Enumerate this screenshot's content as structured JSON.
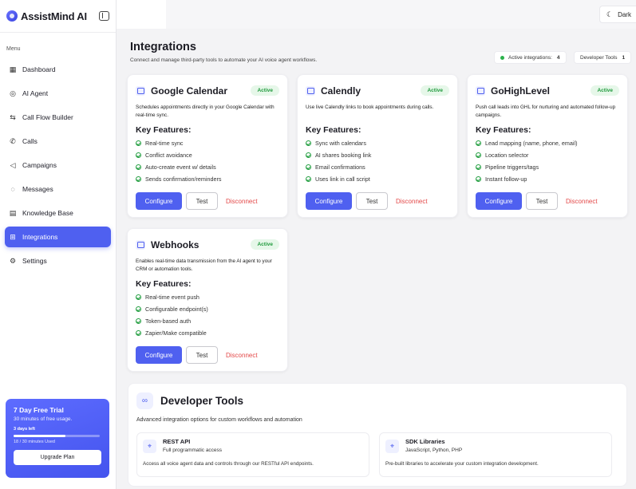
{
  "brand": {
    "name": "AssistMind AI"
  },
  "sidebar": {
    "menu_label": "Menu",
    "items": [
      {
        "label": "Dashboard",
        "icon": "grid-icon",
        "active": false
      },
      {
        "label": "AI Agent",
        "icon": "bot-icon",
        "active": false
      },
      {
        "label": "Call Flow Builder",
        "icon": "flow-icon",
        "active": false
      },
      {
        "label": "Calls",
        "icon": "phone-icon",
        "active": false
      },
      {
        "label": "Campaigns",
        "icon": "megaphone-icon",
        "active": false
      },
      {
        "label": "Messages",
        "icon": "message-icon",
        "active": false
      },
      {
        "label": "Knowledge Base",
        "icon": "book-icon",
        "active": false
      },
      {
        "label": "Integrations",
        "icon": "integrations-icon",
        "active": true
      },
      {
        "label": "Settings",
        "icon": "gear-icon",
        "active": false
      }
    ]
  },
  "trial": {
    "title": "7 Day Free Trial",
    "desc": "30 minutes of free usage.",
    "days_left": "3 days left",
    "usage": "18 / 30 minutes Used",
    "usage_fraction": 0.6,
    "upgrade_label": "Upgrade Plan"
  },
  "topbar": {
    "theme_label": "Dark"
  },
  "header": {
    "title": "Integrations",
    "subtitle": "Connect and manage third-party tools to automate your AI voice agent workflows.",
    "active_label": "Active integrations:",
    "active_count": "4",
    "devtools_label": "Developer Tools",
    "devtools_count": "1"
  },
  "cards": [
    {
      "title": "Google Calendar",
      "status": "Active",
      "desc": "Schedules appointments directly in your Google Calendar with real-time sync.",
      "features_title": "Key Features:",
      "features": [
        "Real-time sync",
        "Conflict avoidance",
        "Auto-create event w/ details",
        "Sends confirmation/reminders"
      ],
      "configure": "Configure",
      "test": "Test",
      "disconnect": "Disconnect"
    },
    {
      "title": "Calendly",
      "status": "Active",
      "desc": "Use live Calendly links to book appointments during calls.",
      "features_title": "Key Features:",
      "features": [
        "Sync with calendars",
        "AI shares booking link",
        "Email confirmations",
        "Uses link in call script"
      ],
      "configure": "Configure",
      "test": "Test",
      "disconnect": "Disconnect"
    },
    {
      "title": "GoHighLevel",
      "status": "Active",
      "desc": "Push call leads into GHL for nurturing and automated follow-up campaigns.",
      "features_title": "Key Features:",
      "features": [
        "Lead mapping (name, phone, email)",
        "Location selector",
        "Pipeline triggers/tags",
        "Instant follow-up"
      ],
      "configure": "Configure",
      "test": "Test",
      "disconnect": "Disconnect"
    },
    {
      "title": "Webhooks",
      "status": "Active",
      "desc": "Enables real-time data transmission from the AI agent to your CRM or automation tools.",
      "features_title": "Key Features:",
      "features": [
        "Real-time event push",
        "Configurable endpoint(s)",
        "Token-based auth",
        "Zapier/Make compatible"
      ],
      "configure": "Configure",
      "test": "Test",
      "disconnect": "Disconnect"
    }
  ],
  "devtools": {
    "title": "Developer Tools",
    "subtitle": "Advanced integration options for custom workflows and automation",
    "items": [
      {
        "title": "REST API",
        "sub": "Full programmatic access",
        "desc": "Access all voice agent data and controls through our RESTful API endpoints."
      },
      {
        "title": "SDK Libraries",
        "sub": "JavaScript, Python, PHP",
        "desc": "Pre-built libraries to accelerate your custom integration development."
      }
    ]
  }
}
